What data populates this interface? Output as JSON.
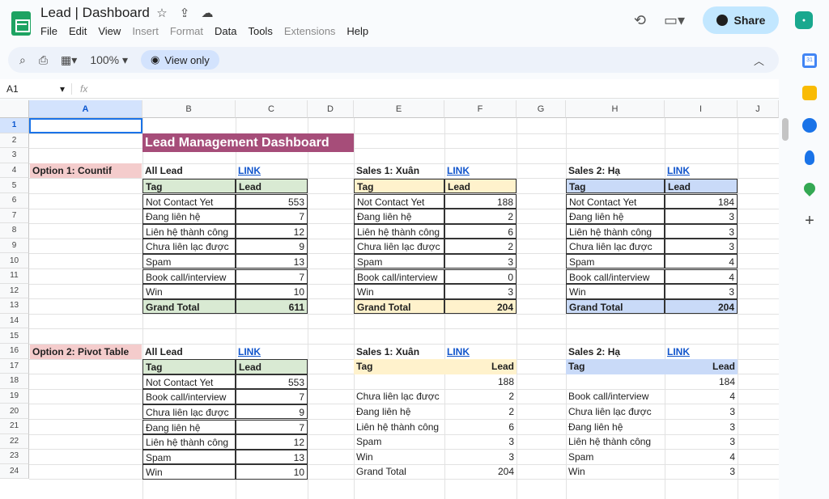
{
  "app": {
    "title": "Lead | Dashboard"
  },
  "menu": [
    "File",
    "Edit",
    "View",
    "Insert",
    "Format",
    "Data",
    "Tools",
    "Extensions",
    "Help"
  ],
  "menu_disabled": [
    "Insert",
    "Format",
    "Extensions"
  ],
  "header": {
    "share_label": "Share"
  },
  "toolbar": {
    "zoom": "100%",
    "view_only": "View only"
  },
  "formula": {
    "namebox": "A1",
    "fx": "fx"
  },
  "columns": [
    "A",
    "B",
    "C",
    "D",
    "E",
    "F",
    "G",
    "H",
    "I",
    "J"
  ],
  "rows": [
    "1",
    "2",
    "3",
    "4",
    "5",
    "6",
    "7",
    "8",
    "9",
    "10",
    "11",
    "12",
    "13",
    "14",
    "15",
    "16",
    "17",
    "18",
    "19",
    "20",
    "21",
    "22",
    "23",
    "24"
  ],
  "sheet": {
    "banner": "Lead Management Dashboard",
    "option1": "Option 1: Countif",
    "option2": "Option 2: Pivot Table",
    "all_lead": "All Lead",
    "sales1": "Sales 1: Xuân",
    "sales2": "Sales 2: Hạ",
    "link": "LINK",
    "tag": "Tag",
    "lead": "Lead",
    "grand_total": "Grand Total"
  },
  "countif": {
    "tags": [
      "Not Contact Yet",
      "Đang liên hệ",
      "Liên hệ thành công",
      "Chưa liên lạc được",
      "Spam",
      "Book call/interview",
      "Win"
    ],
    "all": [
      "553",
      "7",
      "12",
      "9",
      "13",
      "7",
      "10"
    ],
    "all_total": "611",
    "sales1": [
      "188",
      "2",
      "6",
      "2",
      "3",
      "0",
      "3"
    ],
    "sales1_total": "204",
    "sales2": [
      "184",
      "3",
      "3",
      "3",
      "4",
      "4",
      "3"
    ],
    "sales2_total": "204"
  },
  "pivot": {
    "all_tags": [
      "Not Contact Yet",
      "Book call/interview",
      "Chưa liên lạc được",
      "Đang liên hệ",
      "Liên hệ thành công",
      "Spam",
      "Win"
    ],
    "all_vals": [
      "553",
      "7",
      "9",
      "7",
      "12",
      "13",
      "10"
    ],
    "s1_tags": [
      "",
      "Chưa liên lạc được",
      "Đang liên hệ",
      "Liên hệ thành công",
      "Spam",
      "Win",
      "Grand Total"
    ],
    "s1_vals": [
      "188",
      "2",
      "2",
      "6",
      "3",
      "3",
      "204"
    ],
    "s2_tags": [
      "",
      "Book call/interview",
      "Chưa liên lạc được",
      "Đang liên hệ",
      "Liên hệ thành công",
      "Spam",
      "Win"
    ],
    "s2_vals": [
      "184",
      "4",
      "3",
      "3",
      "3",
      "4",
      "3"
    ]
  },
  "colors": {
    "green_header": "#d9ead3",
    "yellow_header": "#fff2cc",
    "blue_header": "#c9daf8",
    "pink_label": "#f4cccc",
    "banner": "#a64d79"
  }
}
